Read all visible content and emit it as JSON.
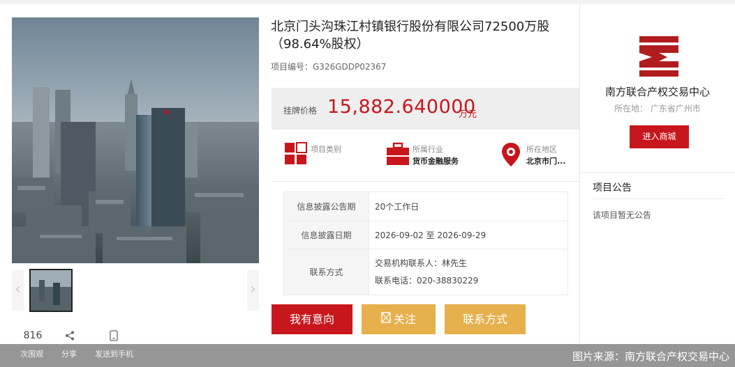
{
  "listing": {
    "title": "北京门头沟珠江村镇银行股份有限公司72500万股（98.64%股权）",
    "code": "项目编号：G326GDDP02367",
    "price_label": "挂牌价格",
    "price_value": "15,882.640000",
    "price_unit": "万元",
    "accent_color": "#c8161d",
    "gold_color": "#e6b04d"
  },
  "attributes": [
    {
      "icon": "category-grid-icon",
      "label": "项目类别",
      "value": ""
    },
    {
      "icon": "briefcase-icon",
      "label": "所属行业",
      "value": "货币金融服务"
    },
    {
      "icon": "location-pin-icon",
      "label": "所在地区",
      "value": "北京市门..."
    }
  ],
  "info_rows": [
    {
      "key": "信息披露公告期",
      "value": "20个工作日"
    },
    {
      "key": "信息披露日期",
      "value": "2026-09-02 至 2026-09-29"
    },
    {
      "key": "联系方式",
      "lines": [
        "交易机构联系人：林先生",
        "联系电话：020-38830229"
      ]
    }
  ],
  "buttons": {
    "intent": "我有意向",
    "follow": "关注",
    "contact": "联系方式"
  },
  "stats": {
    "views_count": "816",
    "views_label": "次围观",
    "share_label": "分享",
    "mobile_label": "发送到手机"
  },
  "organization": {
    "name": "南方联合产权交易中心",
    "location": "所在地：  广东省广州市",
    "mall_button": "进入商城"
  },
  "notices": {
    "title": "项目公告",
    "empty": "该项目暂无公告"
  },
  "source": "图片来源：南方联合产权交易中心"
}
